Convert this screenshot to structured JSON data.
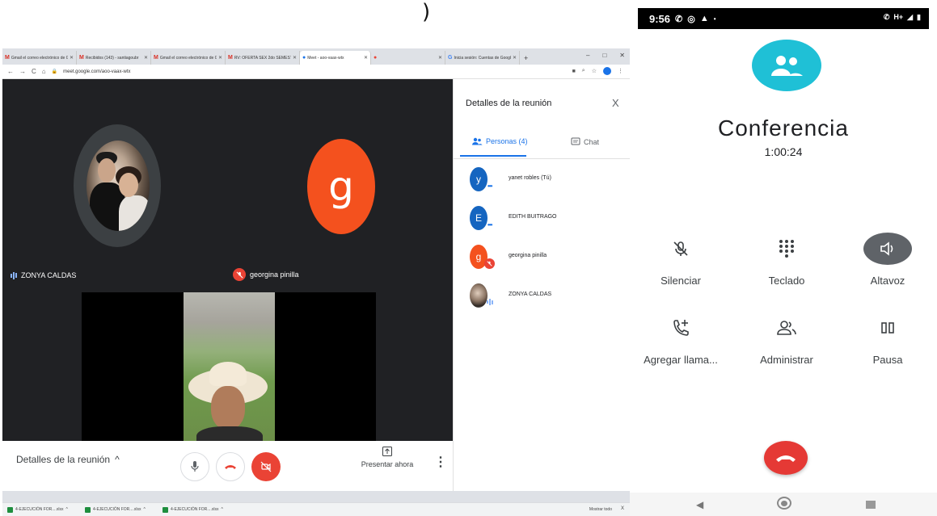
{
  "top_glyph": ")",
  "browser": {
    "tabs": [
      {
        "icon": "M",
        "icon_color": "#d93025",
        "label": "Gmail el correo electrónico de G"
      },
      {
        "icon": "M",
        "icon_color": "#d93025",
        "label": "Recibidos (143) - santiagoubr"
      },
      {
        "icon": "M",
        "icon_color": "#d93025",
        "label": "Gmail el correo electrónico de G"
      },
      {
        "icon": "M",
        "icon_color": "#d93025",
        "label": "RV: OFERTA SEX 2do SEMESTRE"
      },
      {
        "icon": "●",
        "icon_color": "#1a73e8",
        "label": "Meet - aoo-vaax-wtx",
        "active": true
      },
      {
        "icon": "●",
        "icon_color": "#ea4335",
        "label": ""
      },
      {
        "icon": "G",
        "icon_color": "#4285f4",
        "label": "Inicia sesión: Cuentas de Google"
      }
    ],
    "new_tab": "+",
    "window_controls": [
      "–",
      "□",
      "✕"
    ],
    "url": "meet.google.com/aoo-vaax-wtx",
    "profile_initial": "y"
  },
  "meet": {
    "tile_names": {
      "zonya": "ZONYA CALDAS",
      "georgina": "georgina pinilla"
    },
    "avatar_letter": "g",
    "controls": {
      "details_label": "Detalles de la reunión",
      "details_chevron": "^",
      "present_label": "Presentar ahora",
      "more": "⋮"
    }
  },
  "panel": {
    "title": "Detalles de la reunión",
    "close": "X",
    "tab_people": "Personas (4)",
    "tab_chat": "Chat",
    "people": [
      {
        "initial": "y",
        "name": "yanet robles (Tú)",
        "status": "dots",
        "color": "#1565c0"
      },
      {
        "initial": "E",
        "name": "EDITH BUITRAGO",
        "status": "dots",
        "color": "#1565c0"
      },
      {
        "initial": "g",
        "name": "georgina pinilla",
        "status": "muted",
        "color": "#f4511e"
      },
      {
        "initial": "",
        "name": "ZONYA CALDAS",
        "status": "speaking",
        "color": "photo"
      }
    ]
  },
  "taskbar": {
    "downloads": [
      "4-EJECUCIÓN FOR....xlsx",
      "4-EJECUCIÓN FOR....xlsx",
      "4-EJECUCIÓN FOR....xlsx"
    ],
    "show_all": "Mostrar todo",
    "close": "X"
  },
  "phone": {
    "status_time": "9:56",
    "status_icons": "H+",
    "call_title": "Conferencia",
    "call_timer": "1:00:24",
    "actions": [
      {
        "label": "Silenciar"
      },
      {
        "label": "Teclado"
      },
      {
        "label": "Altavoz"
      },
      {
        "label": "Agregar llama..."
      },
      {
        "label": "Administrar"
      },
      {
        "label": "Pausa"
      }
    ],
    "colors": {
      "conference_icon": "#1fc0d6",
      "hangup": "#e53935",
      "speaker_active": "#5f6368"
    }
  }
}
